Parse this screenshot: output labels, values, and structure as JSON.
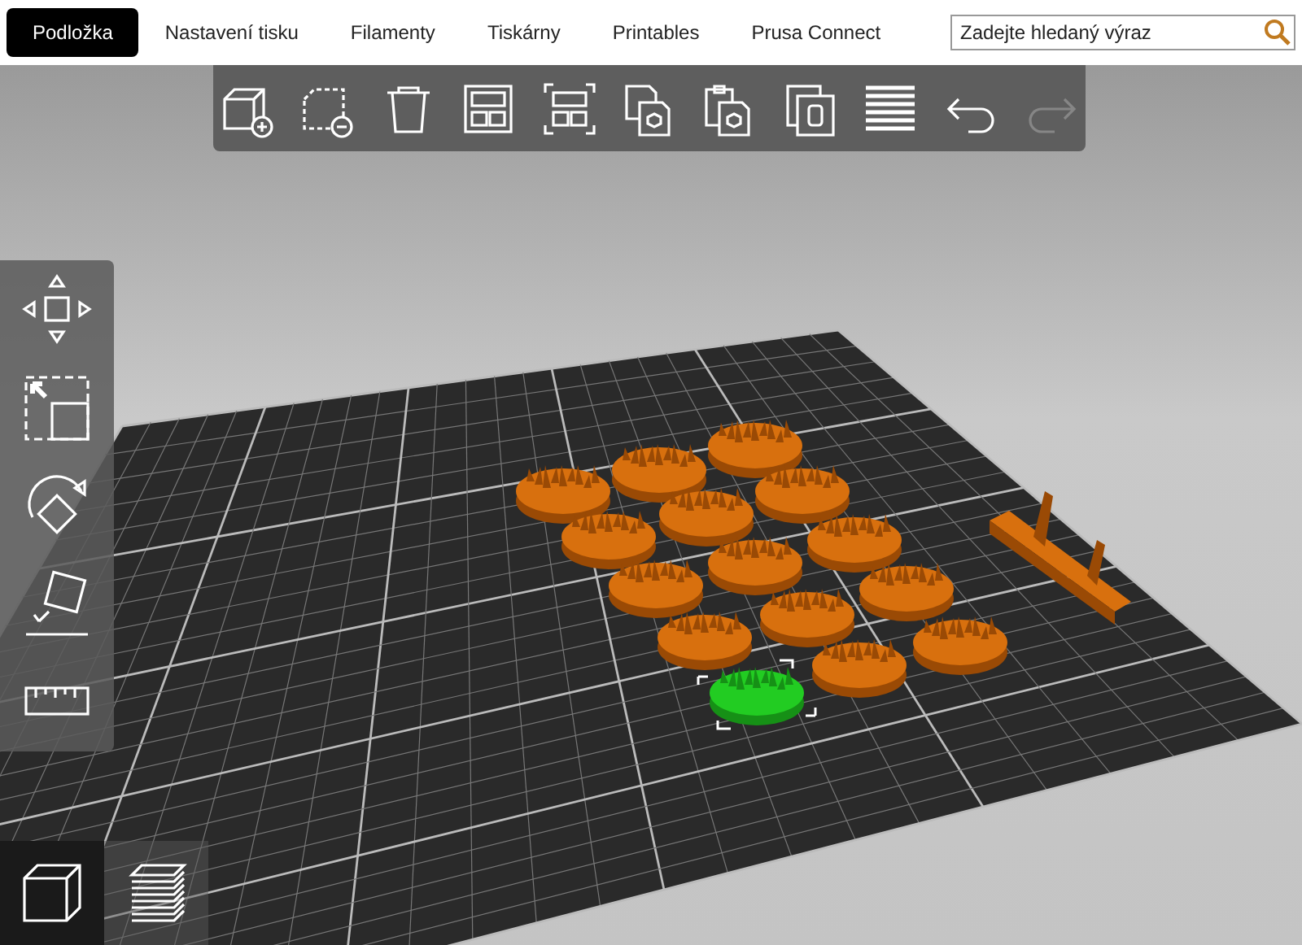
{
  "tabs": [
    {
      "label": "Podložka",
      "selected": true
    },
    {
      "label": "Nastavení tisku",
      "selected": false
    },
    {
      "label": "Filamenty",
      "selected": false
    },
    {
      "label": "Tiskárny",
      "selected": false
    },
    {
      "label": "Printables",
      "selected": false
    },
    {
      "label": "Prusa Connect",
      "selected": false
    }
  ],
  "search": {
    "placeholder": "Zadejte hledaný výraz"
  },
  "top_toolbar": [
    {
      "kind": "add",
      "disabled": false
    },
    {
      "kind": "delete",
      "disabled": false
    },
    {
      "kind": "delete-all",
      "disabled": false
    },
    {
      "kind": "arrange",
      "disabled": false
    },
    {
      "kind": "arrange-selection",
      "disabled": false
    },
    {
      "kind": "copy",
      "disabled": false
    },
    {
      "kind": "paste",
      "disabled": false
    },
    {
      "kind": "instances",
      "disabled": false
    },
    {
      "kind": "layers",
      "disabled": false
    },
    {
      "kind": "undo",
      "disabled": false
    },
    {
      "kind": "redo",
      "disabled": true
    }
  ],
  "left_toolbar": [
    {
      "kind": "move"
    },
    {
      "kind": "scale"
    },
    {
      "kind": "rotate"
    },
    {
      "kind": "place-on-face"
    },
    {
      "kind": "measure"
    }
  ],
  "view_toolbar": [
    {
      "kind": "editor",
      "selected": true
    },
    {
      "kind": "preview",
      "selected": false
    }
  ],
  "scene": {
    "objects": [
      {
        "kind": "spiky-base",
        "selected": false
      },
      {
        "kind": "spiky-base",
        "selected": false
      },
      {
        "kind": "spiky-base",
        "selected": false
      },
      {
        "kind": "spiky-base",
        "selected": false
      },
      {
        "kind": "spiky-base",
        "selected": false
      },
      {
        "kind": "spiky-base",
        "selected": false
      },
      {
        "kind": "spiky-base",
        "selected": false
      },
      {
        "kind": "spiky-base",
        "selected": false
      },
      {
        "kind": "spiky-base",
        "selected": false
      },
      {
        "kind": "spiky-base",
        "selected": false
      },
      {
        "kind": "spiky-base",
        "selected": false
      },
      {
        "kind": "spiky-base",
        "selected": false
      },
      {
        "kind": "spiky-base",
        "selected": false
      },
      {
        "kind": "spiky-base",
        "selected": false
      },
      {
        "kind": "spiky-base",
        "selected": true
      },
      {
        "kind": "bar",
        "selected": false
      }
    ]
  }
}
